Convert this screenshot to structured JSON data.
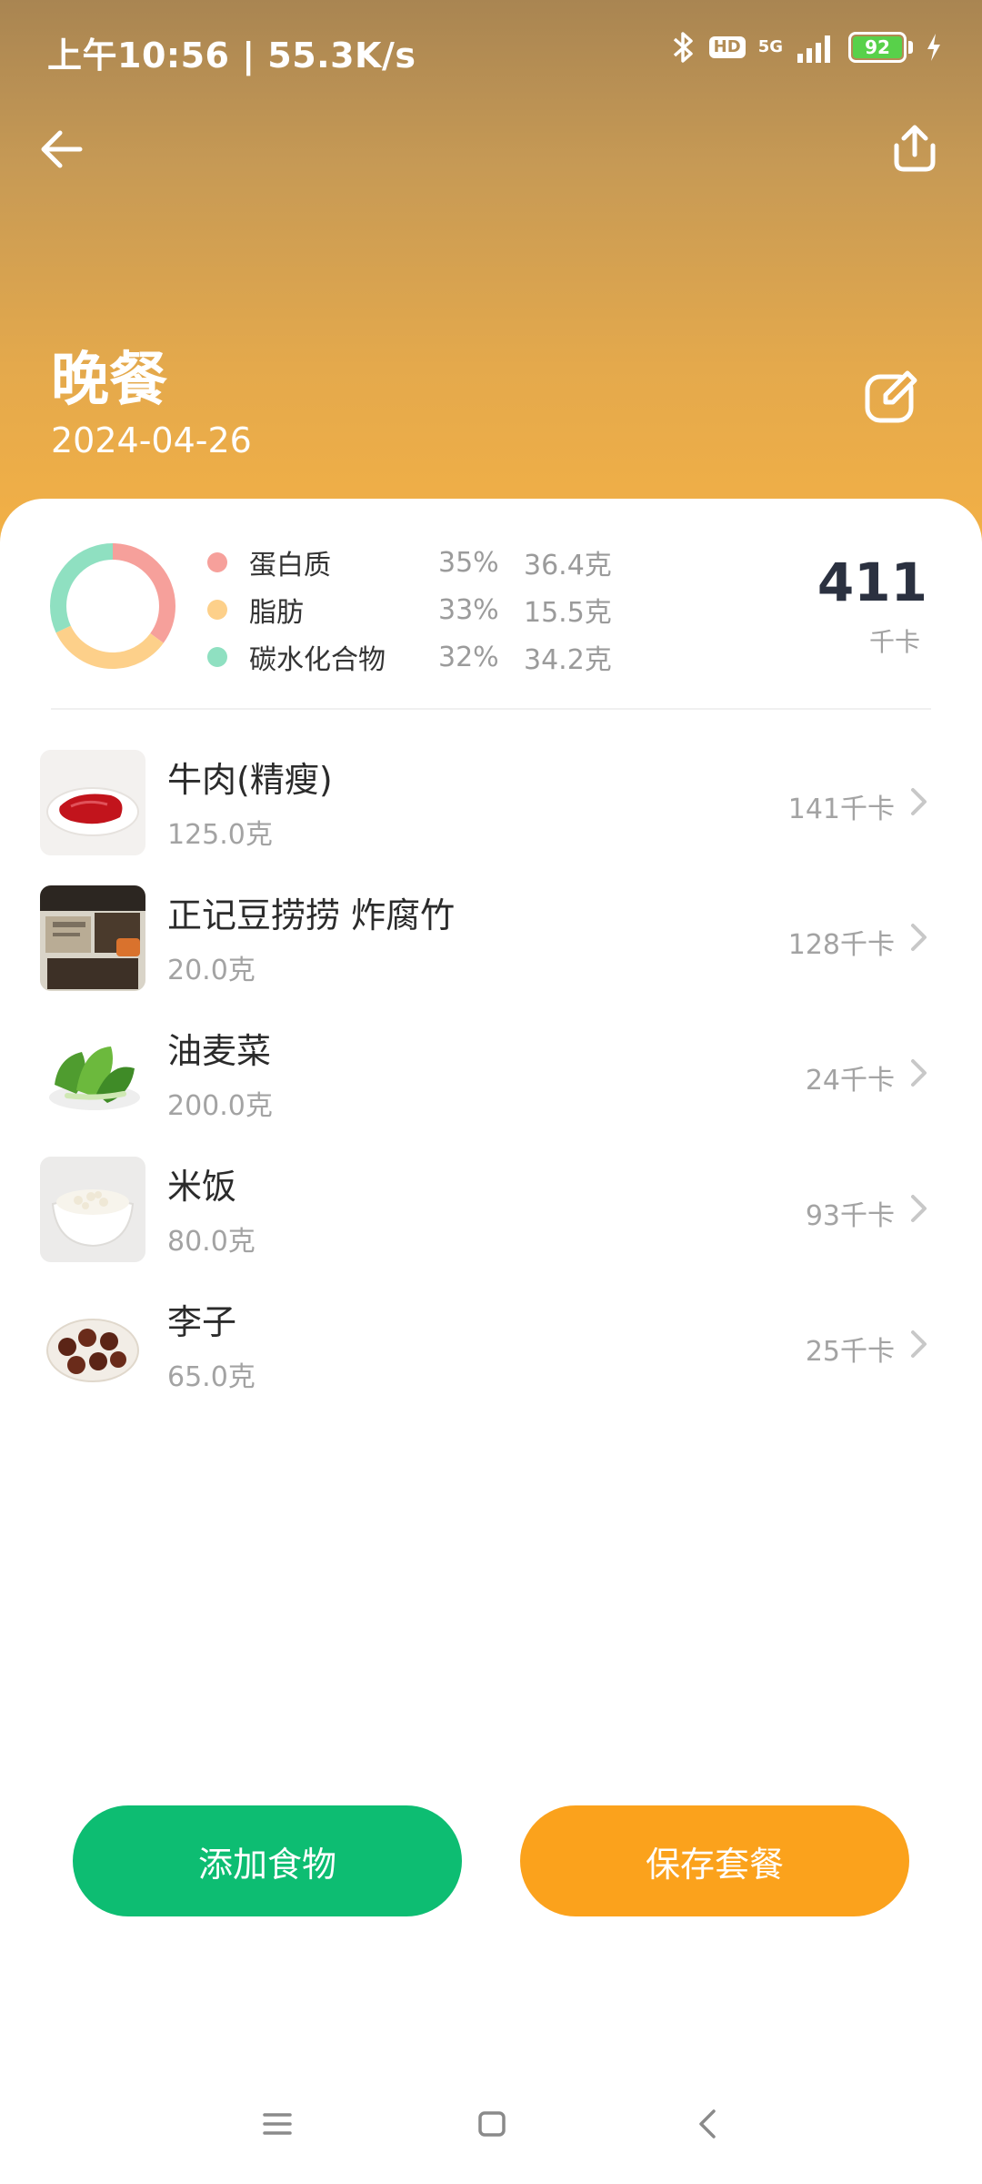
{
  "status_bar": {
    "time_speed": "上午10:56 | 55.3K/s",
    "hd": "HD",
    "network": "5G",
    "battery": "92"
  },
  "meal": {
    "title": "晚餐",
    "date": "2024-04-26"
  },
  "nutrition": {
    "items": [
      {
        "name": "蛋白质",
        "percent": "35%",
        "grams": "36.4克",
        "color": "#f6a09b",
        "fraction": 0.35
      },
      {
        "name": "脂肪",
        "percent": "33%",
        "grams": "15.5克",
        "color": "#fdd08a",
        "fraction": 0.33
      },
      {
        "name": "碳水化合物",
        "percent": "32%",
        "grams": "34.2克",
        "color": "#8fe0c1",
        "fraction": 0.32
      }
    ],
    "total_calories": "411",
    "total_unit": "千卡"
  },
  "foods": [
    {
      "name": "牛肉(精瘦)",
      "amount": "125.0克",
      "calories": "141千卡",
      "thumb": "beef"
    },
    {
      "name": "正记豆捞捞 炸腐竹",
      "amount": "20.0克",
      "calories": "128千卡",
      "thumb": "tofu-skin-pack"
    },
    {
      "name": "油麦菜",
      "amount": "200.0克",
      "calories": "24千卡",
      "thumb": "greens"
    },
    {
      "name": "米饭",
      "amount": "80.0克",
      "calories": "93千卡",
      "thumb": "rice"
    },
    {
      "name": "李子",
      "amount": "65.0克",
      "calories": "25千卡",
      "thumb": "plums"
    }
  ],
  "actions": {
    "add_food": "添加食物",
    "save_combo": "保存套餐"
  },
  "colors": {
    "add_button": "#0dbd72",
    "save_button": "#fba21c"
  }
}
